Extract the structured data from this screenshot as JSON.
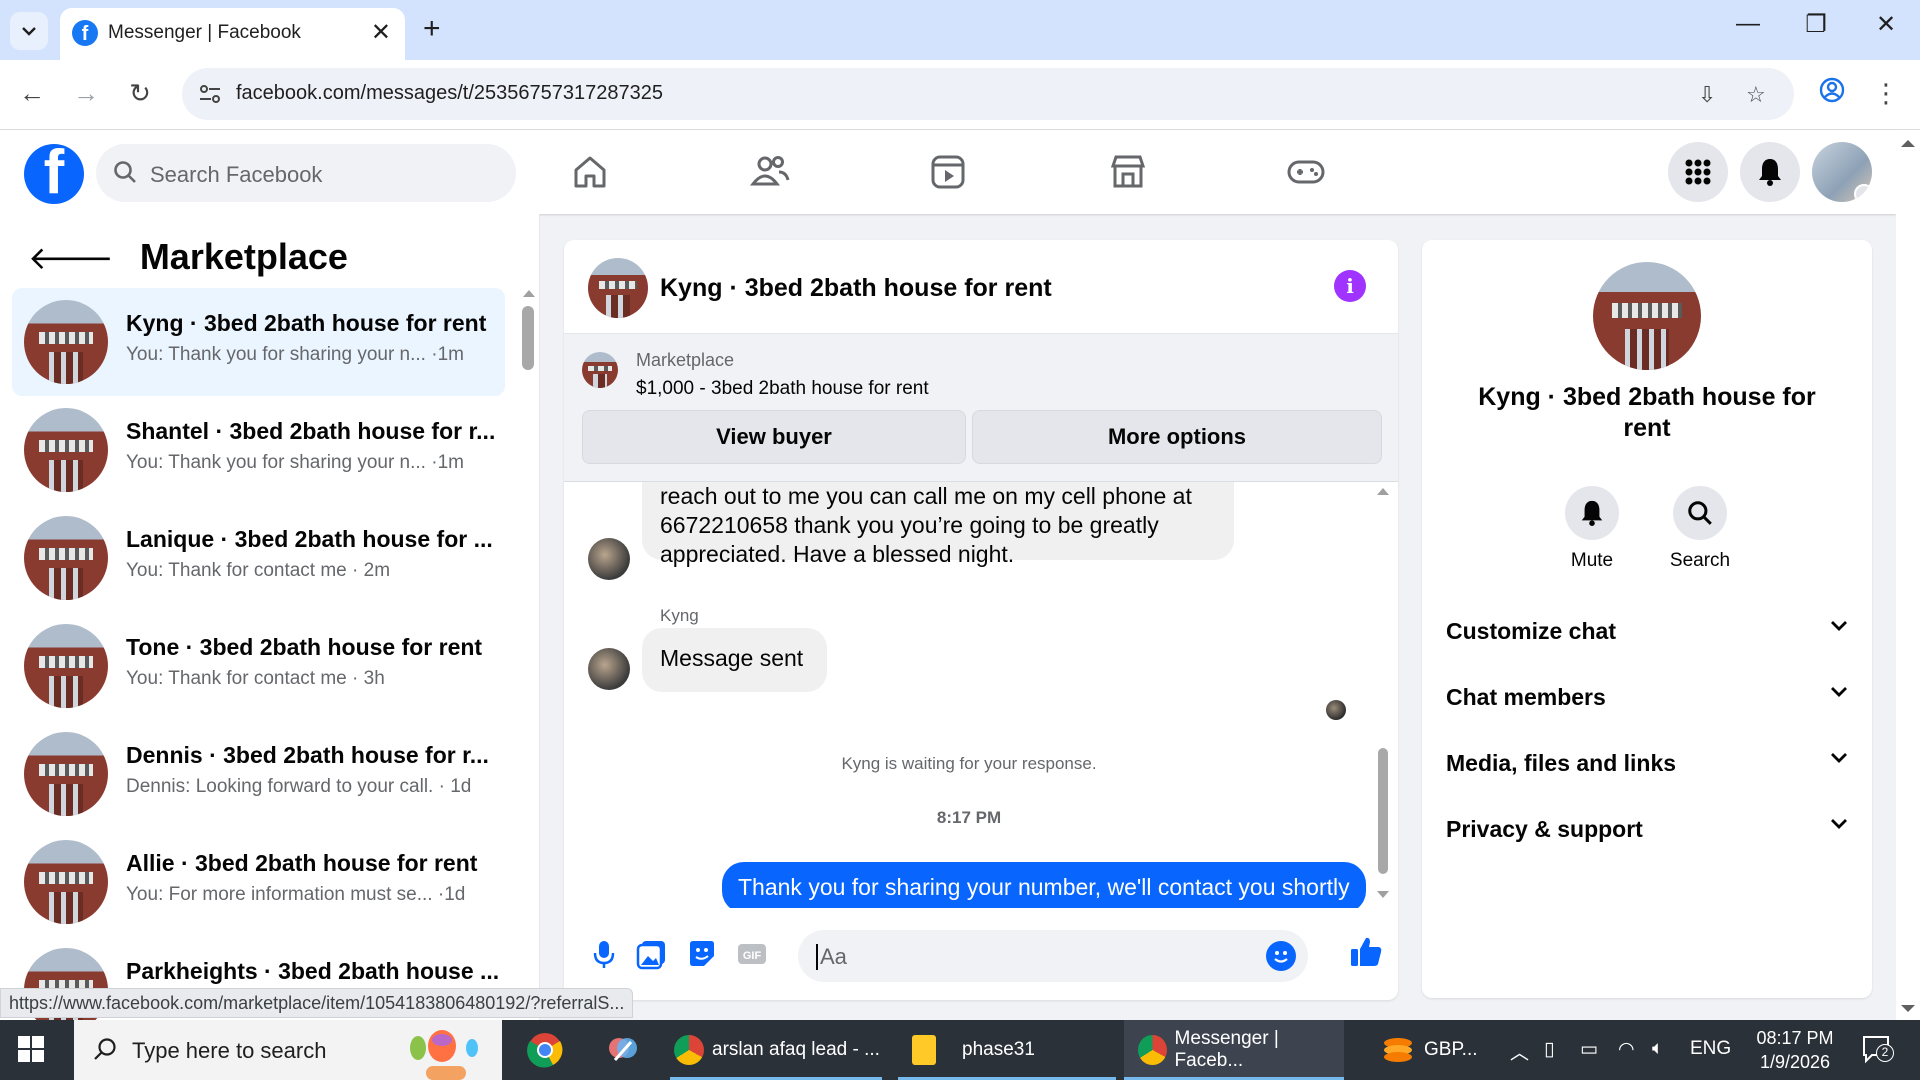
{
  "browser": {
    "tab_title": "Messenger | Facebook",
    "url": "facebook.com/messages/t/25356757317287325",
    "status_link": "https://www.facebook.com/marketplace/item/1054183806480192/?referralS..."
  },
  "header": {
    "search_placeholder": "Search Facebook",
    "nav_icons": [
      "home-icon",
      "friends-icon",
      "video-icon",
      "marketplace-icon",
      "gaming-icon"
    ]
  },
  "sidebar": {
    "title": "Marketplace",
    "conversations": [
      {
        "name": "Kyng · 3bed 2bath house for rent",
        "snippet": "You: Thank you for sharing your n...  ·1m",
        "active": true
      },
      {
        "name": "Shantel · 3bed 2bath house for r...",
        "snippet": "You: Thank you for sharing your n...  ·1m"
      },
      {
        "name": "Lanique · 3bed 2bath house for ...",
        "snippet": "You: Thank for contact me · 2m"
      },
      {
        "name": "Tone · 3bed 2bath house for rent",
        "snippet": "You: Thank for contact me · 3h"
      },
      {
        "name": "Dennis · 3bed 2bath house for r...",
        "snippet": "Dennis: Looking forward to your call. · 1d"
      },
      {
        "name": "Allie · 3bed 2bath house for rent",
        "snippet": "You: For more information must se...  ·1d"
      },
      {
        "name": "Parkheights · 3bed 2bath house ...",
        "snippet": ""
      }
    ]
  },
  "chat": {
    "title": "Kyng · 3bed 2bath house for rent",
    "listing": {
      "label": "Marketplace",
      "price_title": "$1,000 - 3bed 2bath house for rent",
      "view_buyer": "View buyer",
      "more_options": "More options"
    },
    "messages": {
      "incoming_1_line1": "reach out to me you can call me on my cell phone at",
      "incoming_1_line2": "6672210658 thank you you’re going to be greatly",
      "incoming_1_line3": "appreciated. Have a blessed night.",
      "sender": "Kyng",
      "incoming_2": "Message sent",
      "waiting_note": "Kyng is waiting for your response.",
      "timestamp": "8:17 PM",
      "outgoing": "Thank you for sharing your number, we'll contact you shortly"
    },
    "composer_placeholder": "Aa"
  },
  "info_panel": {
    "name": "Kyng · 3bed 2bath house for rent",
    "actions": {
      "mute": "Mute",
      "search": "Search"
    },
    "sections": [
      "Customize chat",
      "Chat members",
      "Media, files and links",
      "Privacy & support"
    ]
  },
  "taskbar": {
    "search_placeholder": "Type here to search",
    "apps": {
      "app1": "arslan afaq lead - ...",
      "app2": "phase31",
      "app3": "Messenger | Faceb..."
    },
    "currency": "GBP...",
    "language": "ENG",
    "time": "08:17 PM",
    "date": "1/9/2026",
    "notifications": "2"
  },
  "colors": {
    "facebook_blue": "#0866ff",
    "info_purple": "#a033ff",
    "selected_conversation": "#ebf5ff"
  }
}
